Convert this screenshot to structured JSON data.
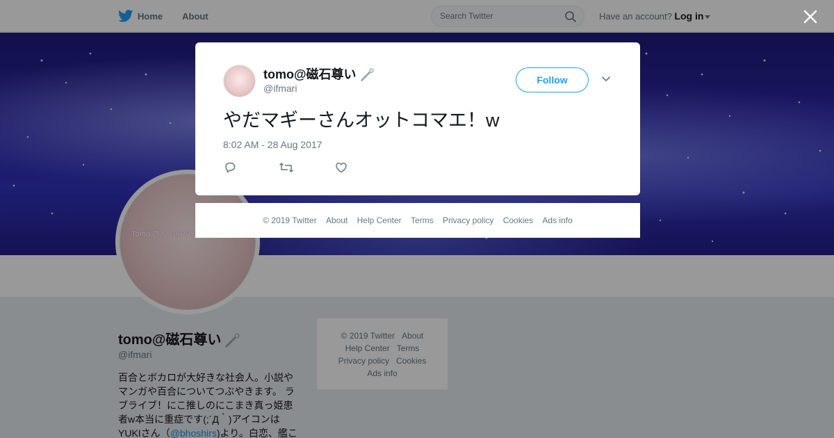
{
  "nav": {
    "home_label": "Home",
    "about_label": "About",
    "search_placeholder": "Search Twitter",
    "account_prompt": "Have an account?",
    "login_label": "Log in"
  },
  "profile": {
    "name": "tomo@磁石尊い",
    "handle": "@ifmari",
    "avatar_text": "Tomo さん HAPPY BIRTH DAY!!",
    "bio_part1": "百合とボカロが大好きな社会人。小説やマンガや百合についてつぶやきます。 ラブライブ！にこ推しのにこまき真っ姫患者w本当に重症です(;´Д｀)アイコンはYUKIさん（",
    "bio_link": "@bhoshirs",
    "bio_part2": ")より。白恋、艦こ"
  },
  "side_footer": {
    "copyright": "© 2019 Twitter",
    "about": "About",
    "help": "Help Center",
    "terms": "Terms",
    "privacy": "Privacy policy",
    "cookies": "Cookies",
    "ads": "Ads info"
  },
  "tweet": {
    "author_name": "tomo@磁石尊い",
    "author_handle": "@ifmari",
    "follow_label": "Follow",
    "text": "やだマギーさんオットコマエ！w",
    "timestamp": "8:02 AM - 28 Aug 2017"
  },
  "modal_footer": {
    "copyright": "© 2019 Twitter",
    "about": "About",
    "help": "Help Center",
    "terms": "Terms",
    "privacy": "Privacy policy",
    "cookies": "Cookies",
    "ads": "Ads info"
  },
  "colors": {
    "brand": "#1da1f2",
    "link": "#1b95e0",
    "muted": "#657786"
  },
  "icons": [
    "twitter-bird-icon",
    "search-icon",
    "caret-down-icon",
    "close-icon",
    "pin-emoji-icon",
    "chevron-down-icon",
    "reply-icon",
    "retweet-icon",
    "like-icon"
  ]
}
